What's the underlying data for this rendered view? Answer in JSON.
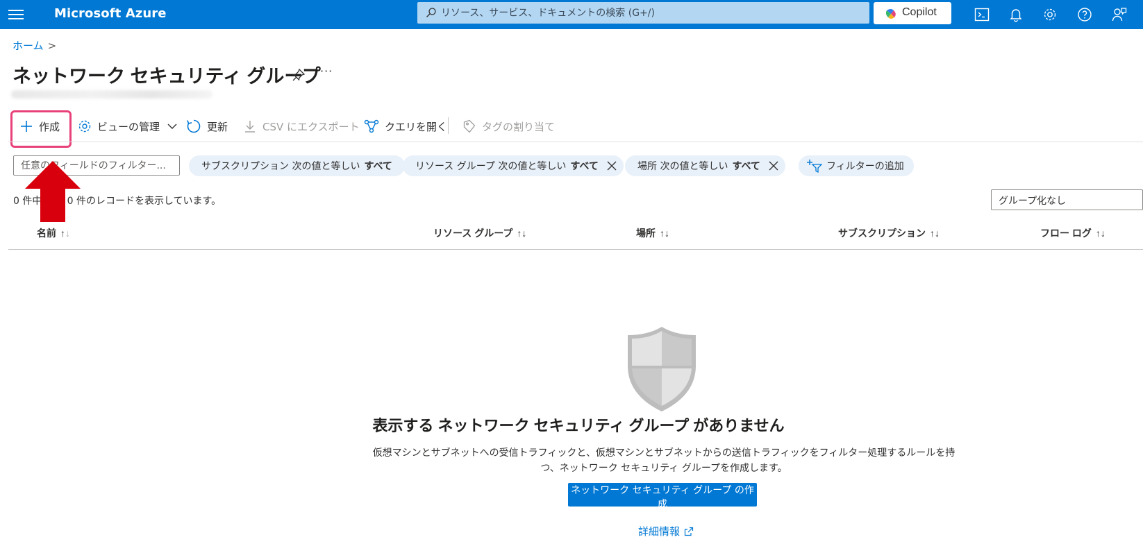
{
  "topbar": {
    "brand": "Microsoft Azure",
    "search_placeholder": "リソース、サービス、ドキュメントの検索 (G+/)",
    "copilot_label": "Copilot",
    "color": "#0078d4",
    "icons": [
      "cloud-shell-icon",
      "bell-icon",
      "gear-icon",
      "help-icon",
      "feedback-icon"
    ]
  },
  "breadcrumb": {
    "home": "ホーム",
    "sep": ">"
  },
  "page": {
    "title": "ネットワーク セキュリティ グループ"
  },
  "commands": {
    "create": "作成",
    "manage_view": "ビューの管理",
    "refresh": "更新",
    "export_csv": "CSV にエクスポート",
    "open_query": "クエリを開く",
    "assign_tags": "タグの割り当て"
  },
  "filters": {
    "placeholder": "任意のフィールドのフィルター...",
    "pills": [
      {
        "label": "サブスクリプション 次の値と等しい",
        "value": "すべて"
      },
      {
        "label": "リソース グループ 次の値と等しい",
        "value": "すべて"
      },
      {
        "label": "場所 次の値と等しい",
        "value": "すべて"
      }
    ],
    "add_filter": "フィルターの追加"
  },
  "records_text": "0 件中 0 ～ 0 件のレコードを表示しています。",
  "grouping": "グループ化なし",
  "columns": [
    "名前",
    "リソース グループ",
    "場所",
    "サブスクリプション",
    "フロー ログ"
  ],
  "empty": {
    "title": "表示する ネットワーク セキュリティ グループ がありません",
    "description": "仮想マシンとサブネットへの受信トラフィックと、仮想マシンとサブネットからの送信トラフィックをフィルター処理するルールを持つ、ネットワーク セキュリティ グループを作成します。",
    "button": "ネットワーク セキュリティ グループ の作成",
    "learn_more": "詳細情報"
  },
  "annotation": {
    "highlight_color": "#e8407a",
    "arrow_color": "#d9000d"
  }
}
